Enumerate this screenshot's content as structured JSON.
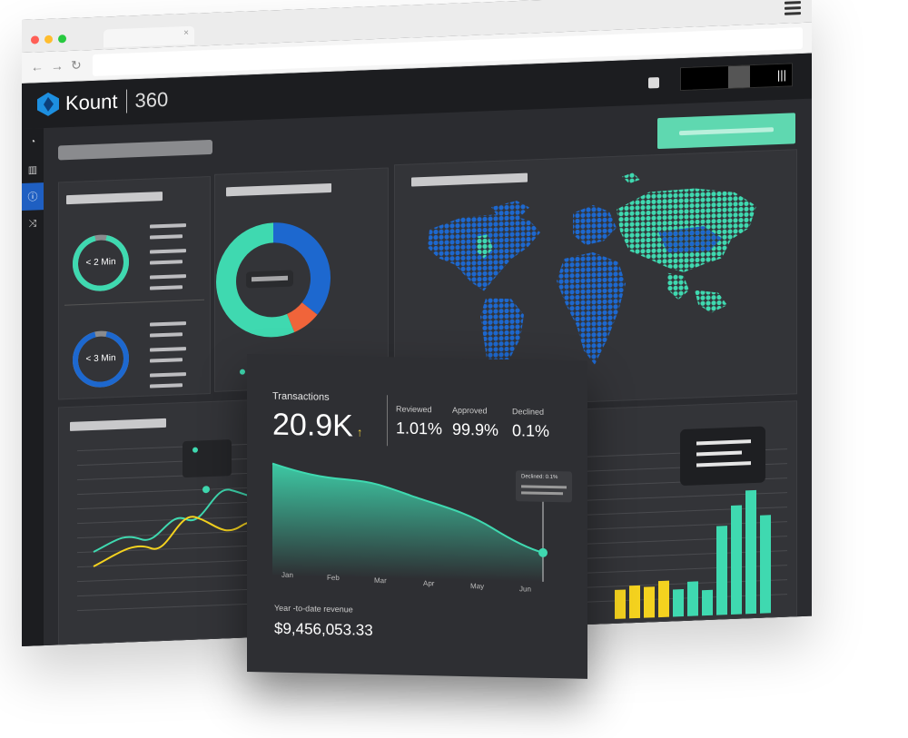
{
  "app": {
    "brand": "Kount",
    "brand_suffix": "360"
  },
  "card": {
    "transactions_label": "Transactions",
    "transactions_value": "20.9K",
    "trend_arrow": "↑",
    "reviewed_label": "Reviewed",
    "reviewed_value": "1.01%",
    "approved_label": "Approved",
    "approved_value": "99.9%",
    "declined_label": "Declined",
    "declined_value": "0.1%",
    "tooltip_label": "Declined: 0.1%",
    "months": [
      "Jan",
      "Feb",
      "Mar",
      "Apr",
      "May",
      "Jun"
    ],
    "revenue_label": "Year -to-date revenue",
    "revenue_value": "$9,456,053.33"
  },
  "gauges": [
    {
      "label": "< 2 Min",
      "fraction": 0.93,
      "color": "#3fd9b0"
    },
    {
      "label": "< 3 Min",
      "fraction": 0.93,
      "color": "#1d68cf"
    }
  ],
  "donut": {
    "segments": [
      {
        "fraction": 0.36,
        "color": "#1d68cf"
      },
      {
        "fraction": 0.08,
        "color": "#f0643a"
      },
      {
        "fraction": 0.56,
        "color": "#3fd9b0"
      }
    ]
  },
  "colors": {
    "teal": "#3fd9b0",
    "blue": "#1d68cf",
    "orange": "#f0643a",
    "yellow": "#f4d21f"
  },
  "icons": {
    "sidebar": [
      "dashboard-icon",
      "bar-chart-icon",
      "info-icon",
      "shuffle-icon"
    ]
  }
}
